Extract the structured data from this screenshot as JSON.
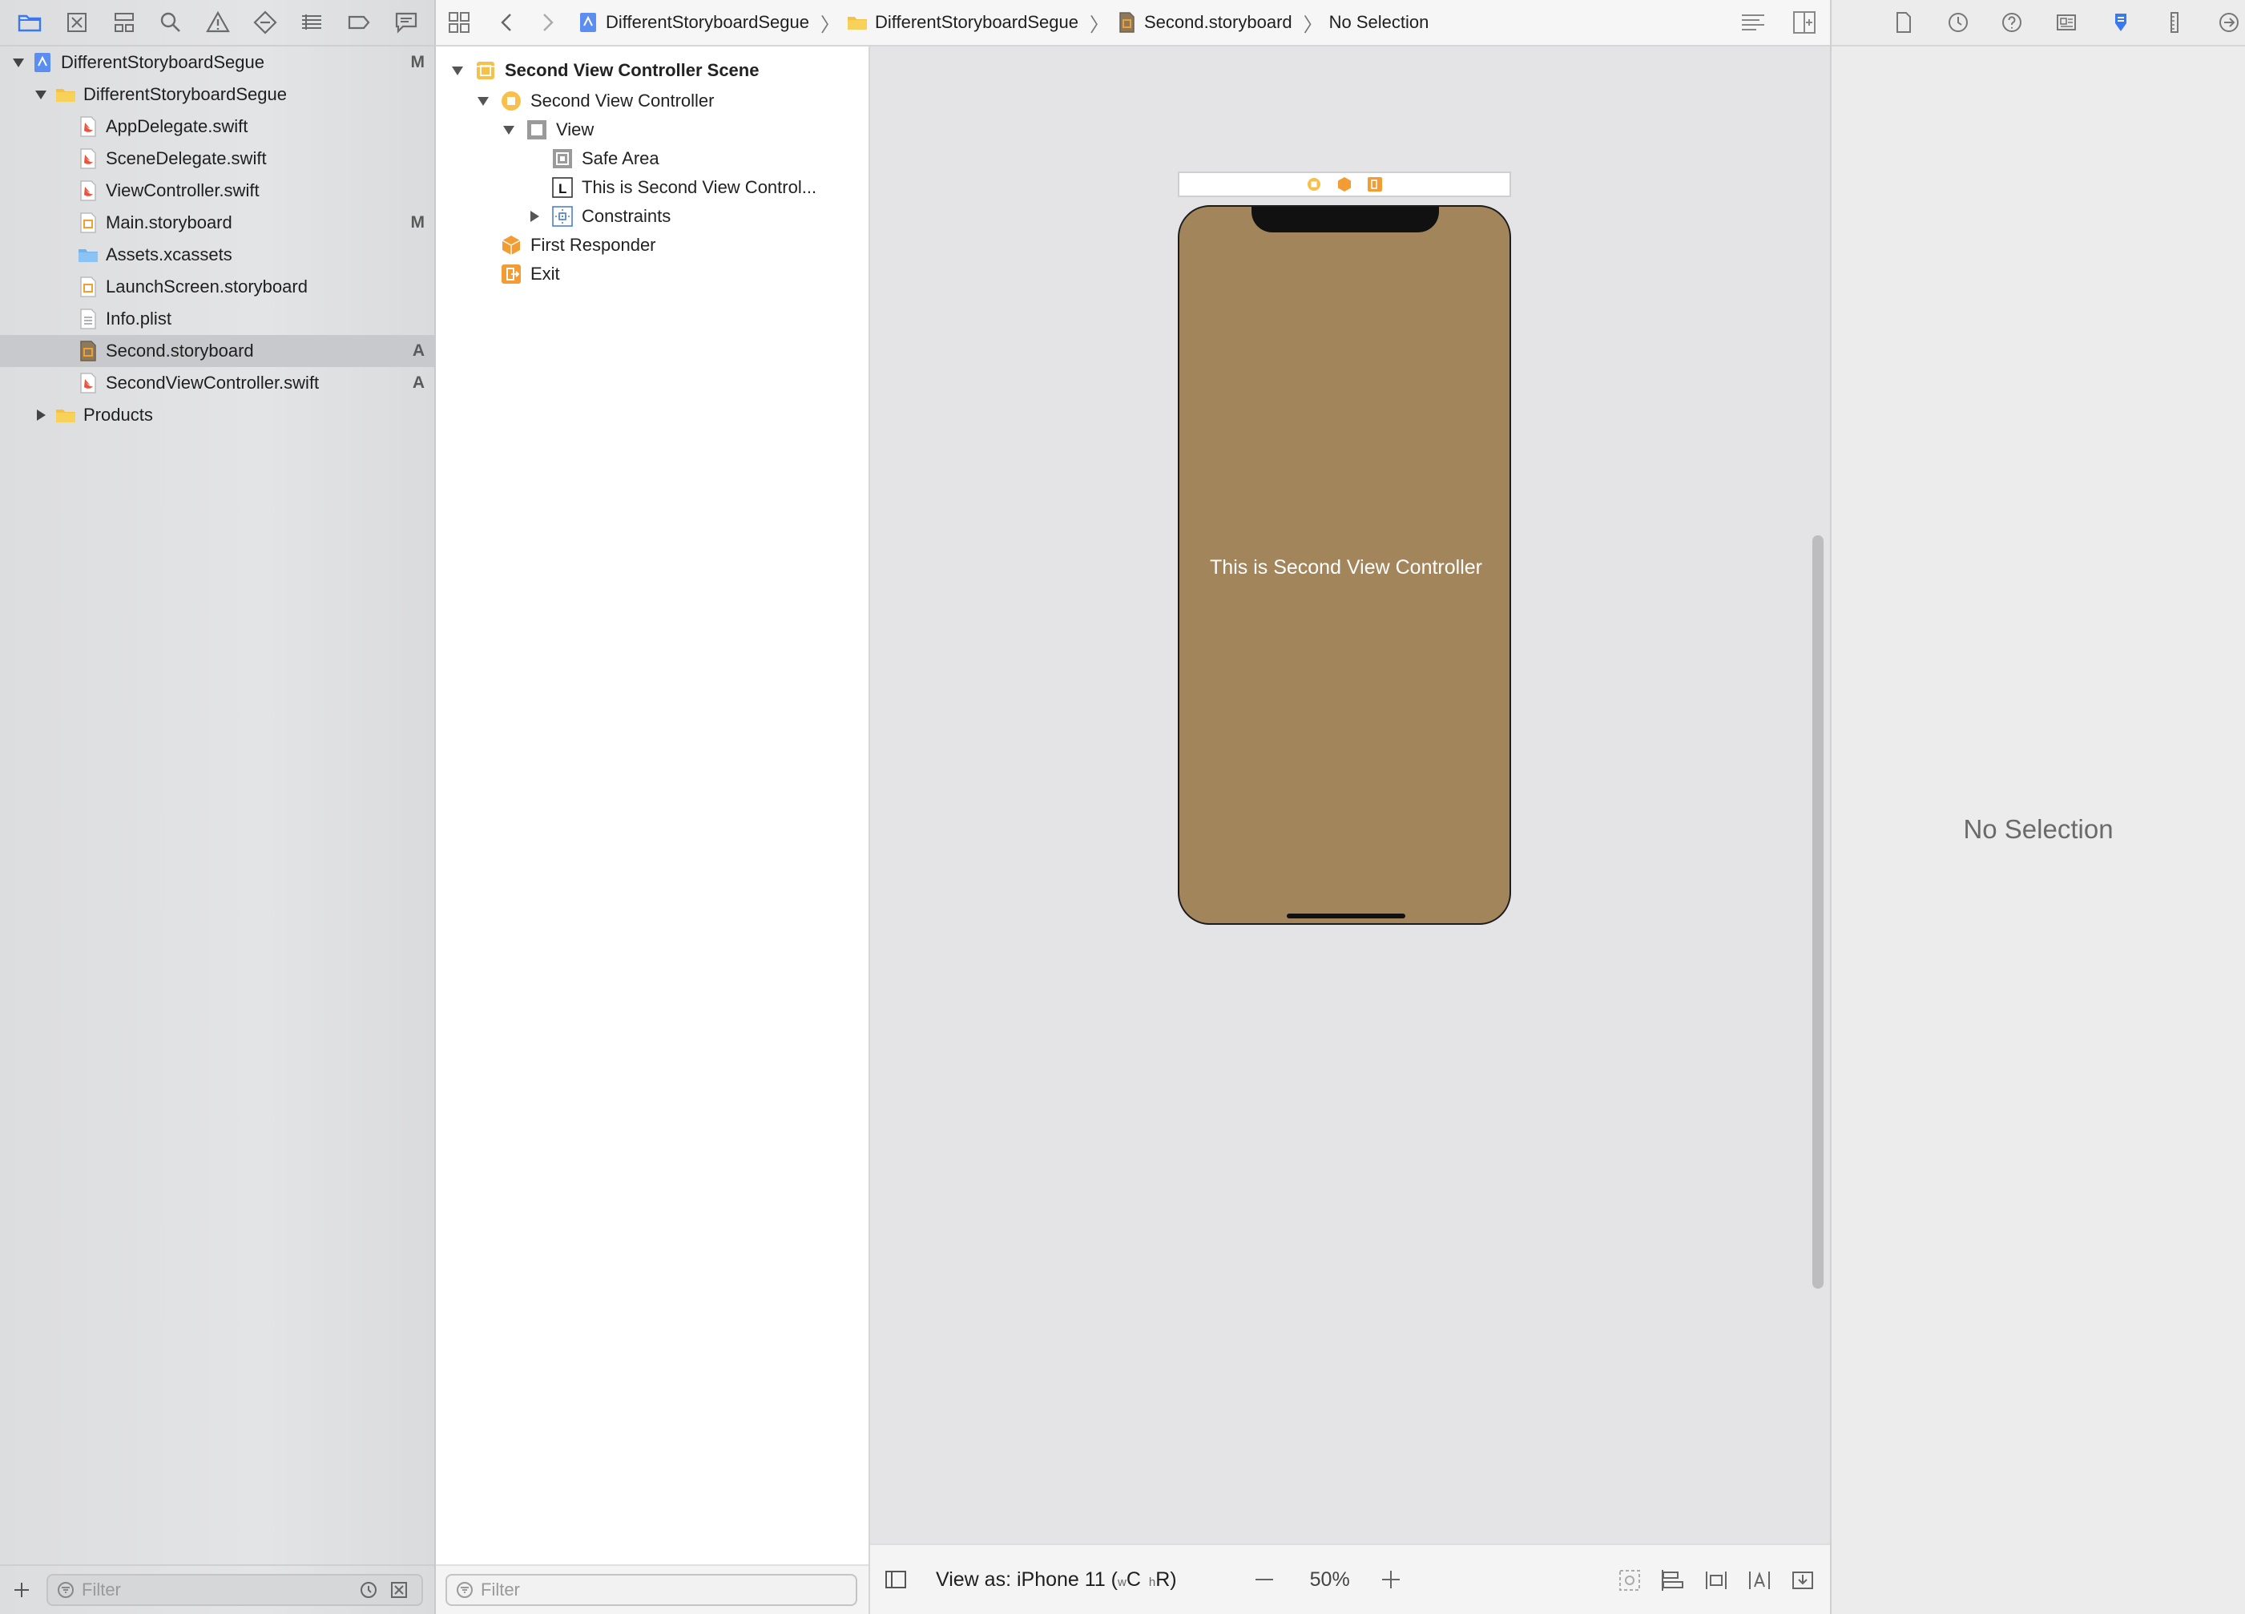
{
  "navigator": {
    "toolbar_icons": [
      "folder-icon",
      "source-control-icon",
      "hierarchy-icon",
      "find-icon",
      "issue-warning-icon",
      "test-diamond-icon",
      "debug-list-icon",
      "breakpoint-tag-icon",
      "report-bubble-icon"
    ],
    "tree": {
      "project": {
        "label": "DifferentStoryboardSegue",
        "badge": "M"
      },
      "group": {
        "label": "DifferentStoryboardSegue"
      },
      "files": [
        {
          "label": "AppDelegate.swift",
          "badge": "",
          "icon": "swift-file-icon"
        },
        {
          "label": "SceneDelegate.swift",
          "badge": "",
          "icon": "swift-file-icon"
        },
        {
          "label": "ViewController.swift",
          "badge": "",
          "icon": "swift-file-icon"
        },
        {
          "label": "Main.storyboard",
          "badge": "M",
          "icon": "storyboard-file-icon"
        },
        {
          "label": "Assets.xcassets",
          "badge": "",
          "icon": "asset-catalog-icon"
        },
        {
          "label": "LaunchScreen.storyboard",
          "badge": "",
          "icon": "storyboard-file-icon"
        },
        {
          "label": "Info.plist",
          "badge": "",
          "icon": "plist-file-icon"
        },
        {
          "label": "Second.storyboard",
          "badge": "A",
          "icon": "storyboard-file-icon"
        },
        {
          "label": "SecondViewController.swift",
          "badge": "A",
          "icon": "swift-file-icon"
        }
      ],
      "products": {
        "label": "Products"
      }
    },
    "filter_placeholder": "Filter"
  },
  "jumpbar": {
    "crumbs": [
      "DifferentStoryboardSegue",
      "DifferentStoryboardSegue",
      "Second.storyboard",
      "No Selection"
    ]
  },
  "outline": {
    "scene": "Second View Controller Scene",
    "controller": "Second View Controller",
    "view": "View",
    "safe_area": "Safe Area",
    "label": "This is Second View Control...",
    "constraints": "Constraints",
    "first_responder": "First Responder",
    "exit": "Exit",
    "filter_placeholder": "Filter"
  },
  "canvas": {
    "phone_label": "This is Second View Controller",
    "phone_color": "#a3855b"
  },
  "canvas_bottom": {
    "view_as_prefix": "View as: iPhone 11 (",
    "w_mark": "w",
    "c_mark": "C",
    "h_mark": "h",
    "r_mark": "R)",
    "zoom": "50%"
  },
  "inspector": {
    "no_selection": "No Selection"
  },
  "colors": {
    "accent": "#3a78f2",
    "storyboard_orange": "#f0a030"
  }
}
